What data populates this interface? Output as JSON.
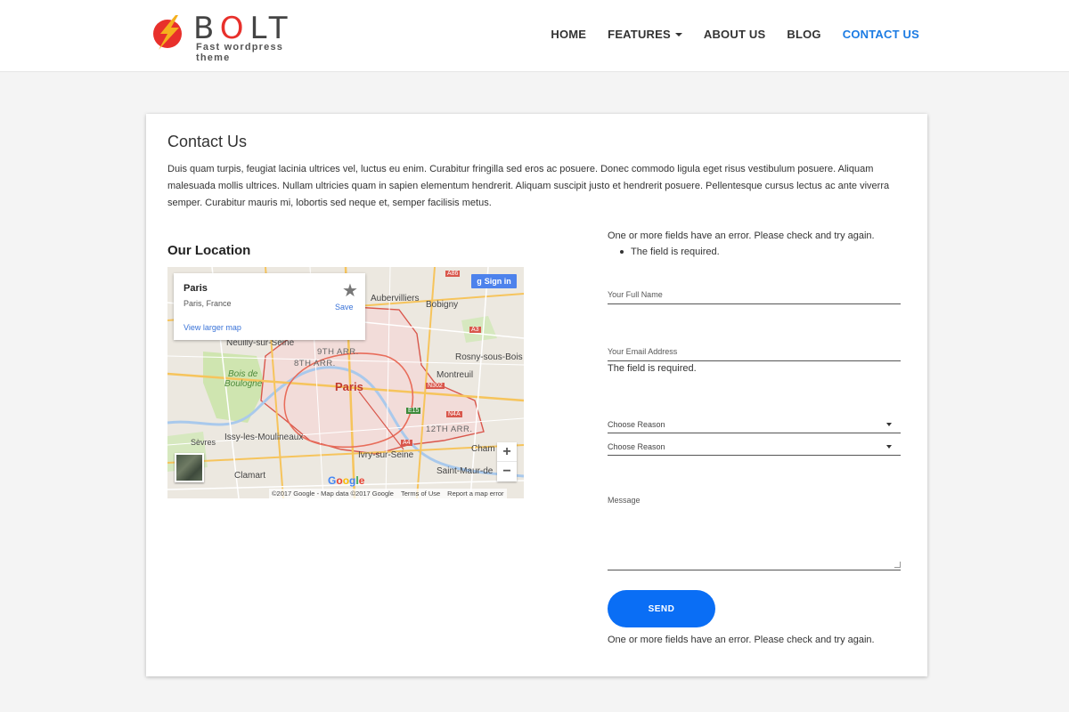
{
  "brand": {
    "name_pre": "B",
    "name_o": "O",
    "name_post": "LT",
    "tagline": "Fast wordpress theme",
    "accent": "#e8302b",
    "bolt_color": "#f5b01d"
  },
  "nav": {
    "items": [
      {
        "label": "HOME"
      },
      {
        "label": "FEATURES"
      },
      {
        "label": "ABOUT US"
      },
      {
        "label": "BLOG"
      },
      {
        "label": "CONTACT US"
      }
    ],
    "active_color": "#1b7be3"
  },
  "page": {
    "title": "Contact Us",
    "intro": "Duis quam turpis, feugiat lacinia ultrices vel, luctus eu enim. Curabitur fringilla sed eros ac posuere. Donec commodo ligula eget risus vestibulum posuere. Aliquam malesuada mollis ultrices. Nullam ultricies quam in sapien elementum hendrerit. Aliquam suscipit justo et hendrerit posuere. Pellentesque cursus lectus ac ante viverra semper. Curabitur mauris mi, lobortis sed neque et, semper facilisis metus.",
    "location_title": "Our Location"
  },
  "map": {
    "place_name": "Paris",
    "place_sub": "Paris, France",
    "save_label": "Save",
    "view_larger": "View larger map",
    "signin_label": "Sign in",
    "zoom_in": "+",
    "zoom_out": "−",
    "google": "Google",
    "attribution": "©2017 Google - Map data ©2017 Google",
    "terms": "Terms of Use",
    "report": "Report a map error",
    "labels": {
      "city": "Paris",
      "aubervilliers": "Aubervilliers",
      "bobigny": "Bobigny",
      "neuilly": "Neuilly-sur-Seine",
      "arr9": "9TH ARR.",
      "arr8": "8TH ARR.",
      "rosny": "Rosny-sous-Bois",
      "boulogne1": "Bois de",
      "boulogne2": "Boulogne",
      "montreuil": "Montreuil",
      "arr12": "12TH ARR.",
      "sevres": "Sèvres",
      "issy": "Issy-les-Moulineaux",
      "ivry": "Ivry-sur-Seine",
      "champigny": "Cham",
      "clamart": "Clamart",
      "stmaur": "Saint-Maur-de"
    },
    "shields": {
      "a86": "A86",
      "a3": "A3",
      "a4": "A4",
      "n302": "N302",
      "e15": "E15",
      "n4a": "N4A"
    }
  },
  "form": {
    "top_error": "One or more fields have an error. Please check and try again.",
    "bullet_error": "The field is required.",
    "name_placeholder": "Your Full Name",
    "email_placeholder": "Your Email Address",
    "email_error": "The field is required.",
    "reason1": "Choose Reason",
    "reason2": "Choose Reason",
    "message_placeholder": "Message",
    "send_label": "SEND",
    "bottom_error": "One or more fields have an error. Please check and try again.",
    "button_color": "#0a6ef5"
  }
}
